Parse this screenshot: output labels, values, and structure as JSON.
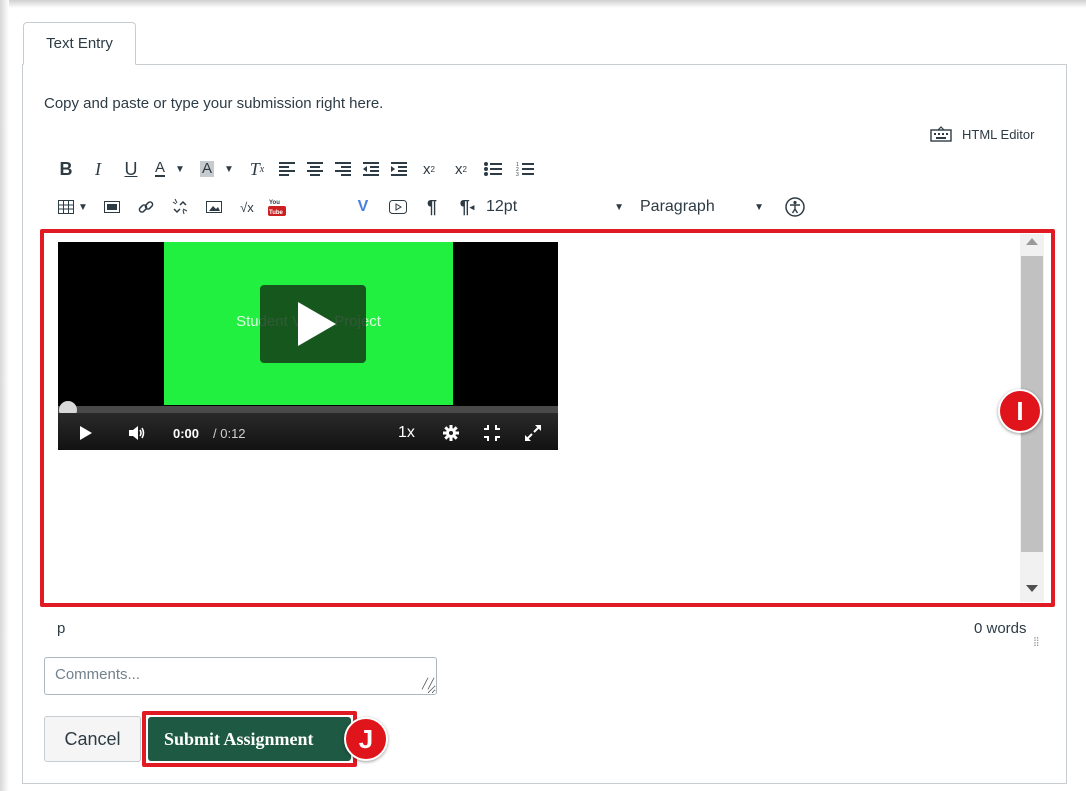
{
  "tabs": [
    {
      "label": "Text Entry"
    }
  ],
  "instructions": "Copy and paste or type your submission right here.",
  "html_editor_label": "HTML Editor",
  "toolbar": {
    "row1": [
      {
        "icon": "bold-icon",
        "glyph": "B"
      },
      {
        "icon": "italic-icon",
        "glyph": "I"
      },
      {
        "icon": "underline-icon",
        "glyph": "U"
      },
      {
        "icon": "text-color-icon",
        "glyph": "A"
      },
      {
        "icon": "background-color-icon",
        "glyph": "A"
      },
      {
        "icon": "clear-formatting-icon",
        "glyph": "Tx"
      },
      {
        "icon": "align-left-icon"
      },
      {
        "icon": "align-center-icon"
      },
      {
        "icon": "align-right-icon"
      },
      {
        "icon": "outdent-icon"
      },
      {
        "icon": "indent-icon"
      },
      {
        "icon": "superscript-icon",
        "glyph": "x²"
      },
      {
        "icon": "subscript-icon",
        "glyph": "x₂"
      },
      {
        "icon": "bullet-list-icon"
      },
      {
        "icon": "numbered-list-icon"
      }
    ],
    "font_size": "12pt",
    "block_format": "Paragraph"
  },
  "video": {
    "title_text": "Student Video Project",
    "current_time": "0:00",
    "total_time": "/ 0:12",
    "speed": "1x",
    "progress": 0
  },
  "badges": {
    "editor": "I",
    "submit": "J"
  },
  "status_bar": {
    "path": "p",
    "word_count": "0 words"
  },
  "comments": {
    "placeholder": "Comments...",
    "value": ""
  },
  "buttons": {
    "cancel": "Cancel",
    "submit": "Submit Assignment"
  },
  "colors": {
    "highlight": "#e01b24",
    "submit_bg": "#1e5a43",
    "video_bg": "#22f041",
    "badge": "#e0141b"
  }
}
